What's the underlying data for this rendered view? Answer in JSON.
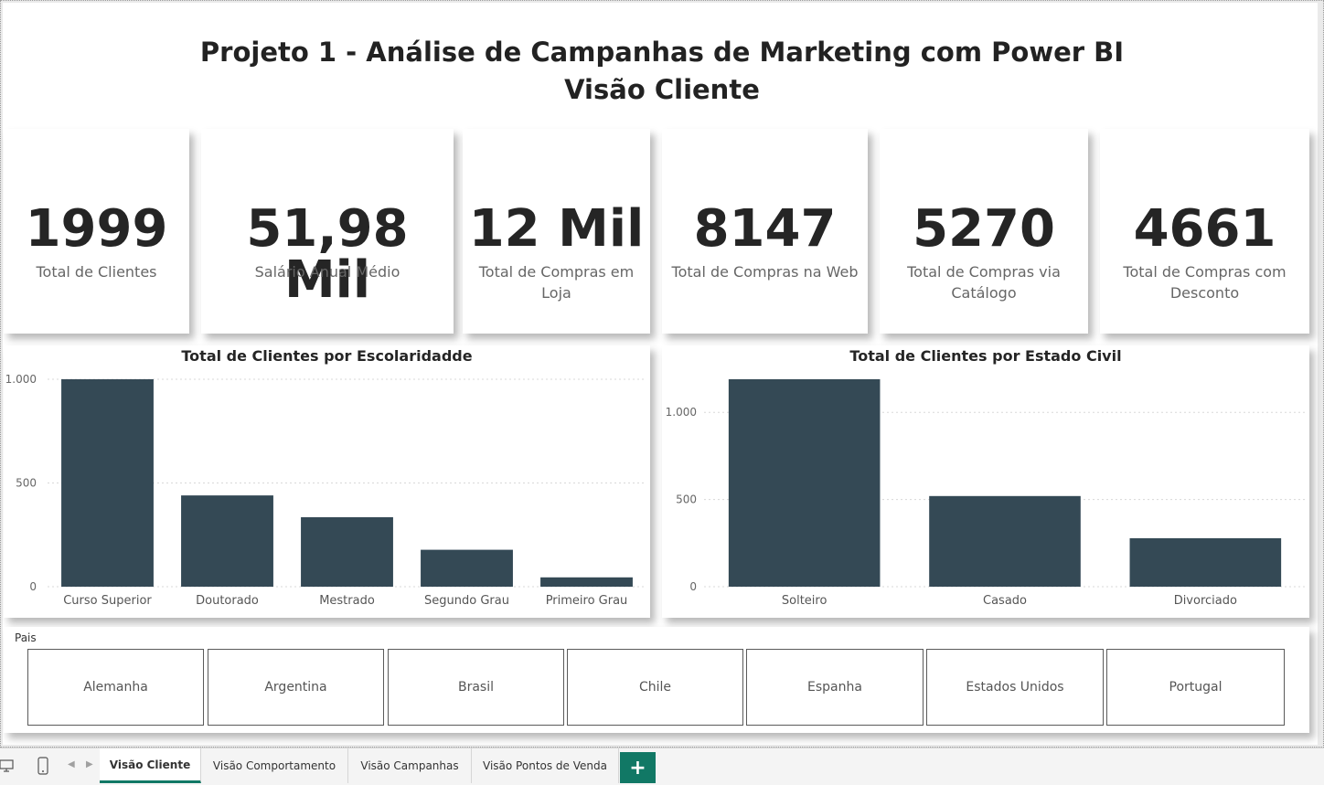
{
  "header": {
    "title": "Projeto 1 - Análise de Campanhas de Marketing com Power BI",
    "subtitle": "Visão Cliente"
  },
  "kpis": [
    {
      "value": "1999",
      "label": "Total de Clientes"
    },
    {
      "value": "51,98 Mil",
      "label": "Salário Anual Médio"
    },
    {
      "value": "12 Mil",
      "label": "Total de Compras em Loja"
    },
    {
      "value": "8147",
      "label": "Total de Compras na Web"
    },
    {
      "value": "5270",
      "label": "Total de Compras via Catálogo"
    },
    {
      "value": "4661",
      "label": "Total de Compras com Desconto"
    }
  ],
  "chart_data": [
    {
      "type": "bar",
      "title": "Total de Clientes por Escolaridadde",
      "categories": [
        "Curso Superior",
        "Doutorado",
        "Mestrado",
        "Segundo Grau",
        "Primeiro Grau"
      ],
      "values": [
        1000,
        440,
        335,
        178,
        45
      ],
      "yticks": [
        "0",
        "500",
        "1.000"
      ],
      "ytick_values": [
        0,
        500,
        1000
      ],
      "ylim": [
        0,
        1000
      ],
      "color": "#344955",
      "grid": true
    },
    {
      "type": "bar",
      "title": "Total de Clientes por Estado Civil",
      "categories": [
        "Solteiro",
        "Casado",
        "Divorciado"
      ],
      "values": [
        1190,
        520,
        278
      ],
      "yticks": [
        "0",
        "500",
        "1.000"
      ],
      "ytick_values": [
        0,
        500,
        1000
      ],
      "ylim": [
        0,
        1190
      ],
      "color": "#344955",
      "grid": true
    }
  ],
  "slicer": {
    "title": "Pais",
    "options": [
      "Alemanha",
      "Argentina",
      "Brasil",
      "Chile",
      "Espanha",
      "Estados Unidos",
      "Portugal"
    ]
  },
  "tabs": {
    "items": [
      "Visão Cliente",
      "Visão Comportamento",
      "Visão Campanhas",
      "Visão Pontos de Venda"
    ],
    "active": "Visão Cliente",
    "add_label": "+",
    "accent": "#117865"
  },
  "icons": [
    "desktop-layout-icon",
    "phone-layout-icon",
    "scroll-left-icon",
    "scroll-right-icon"
  ]
}
